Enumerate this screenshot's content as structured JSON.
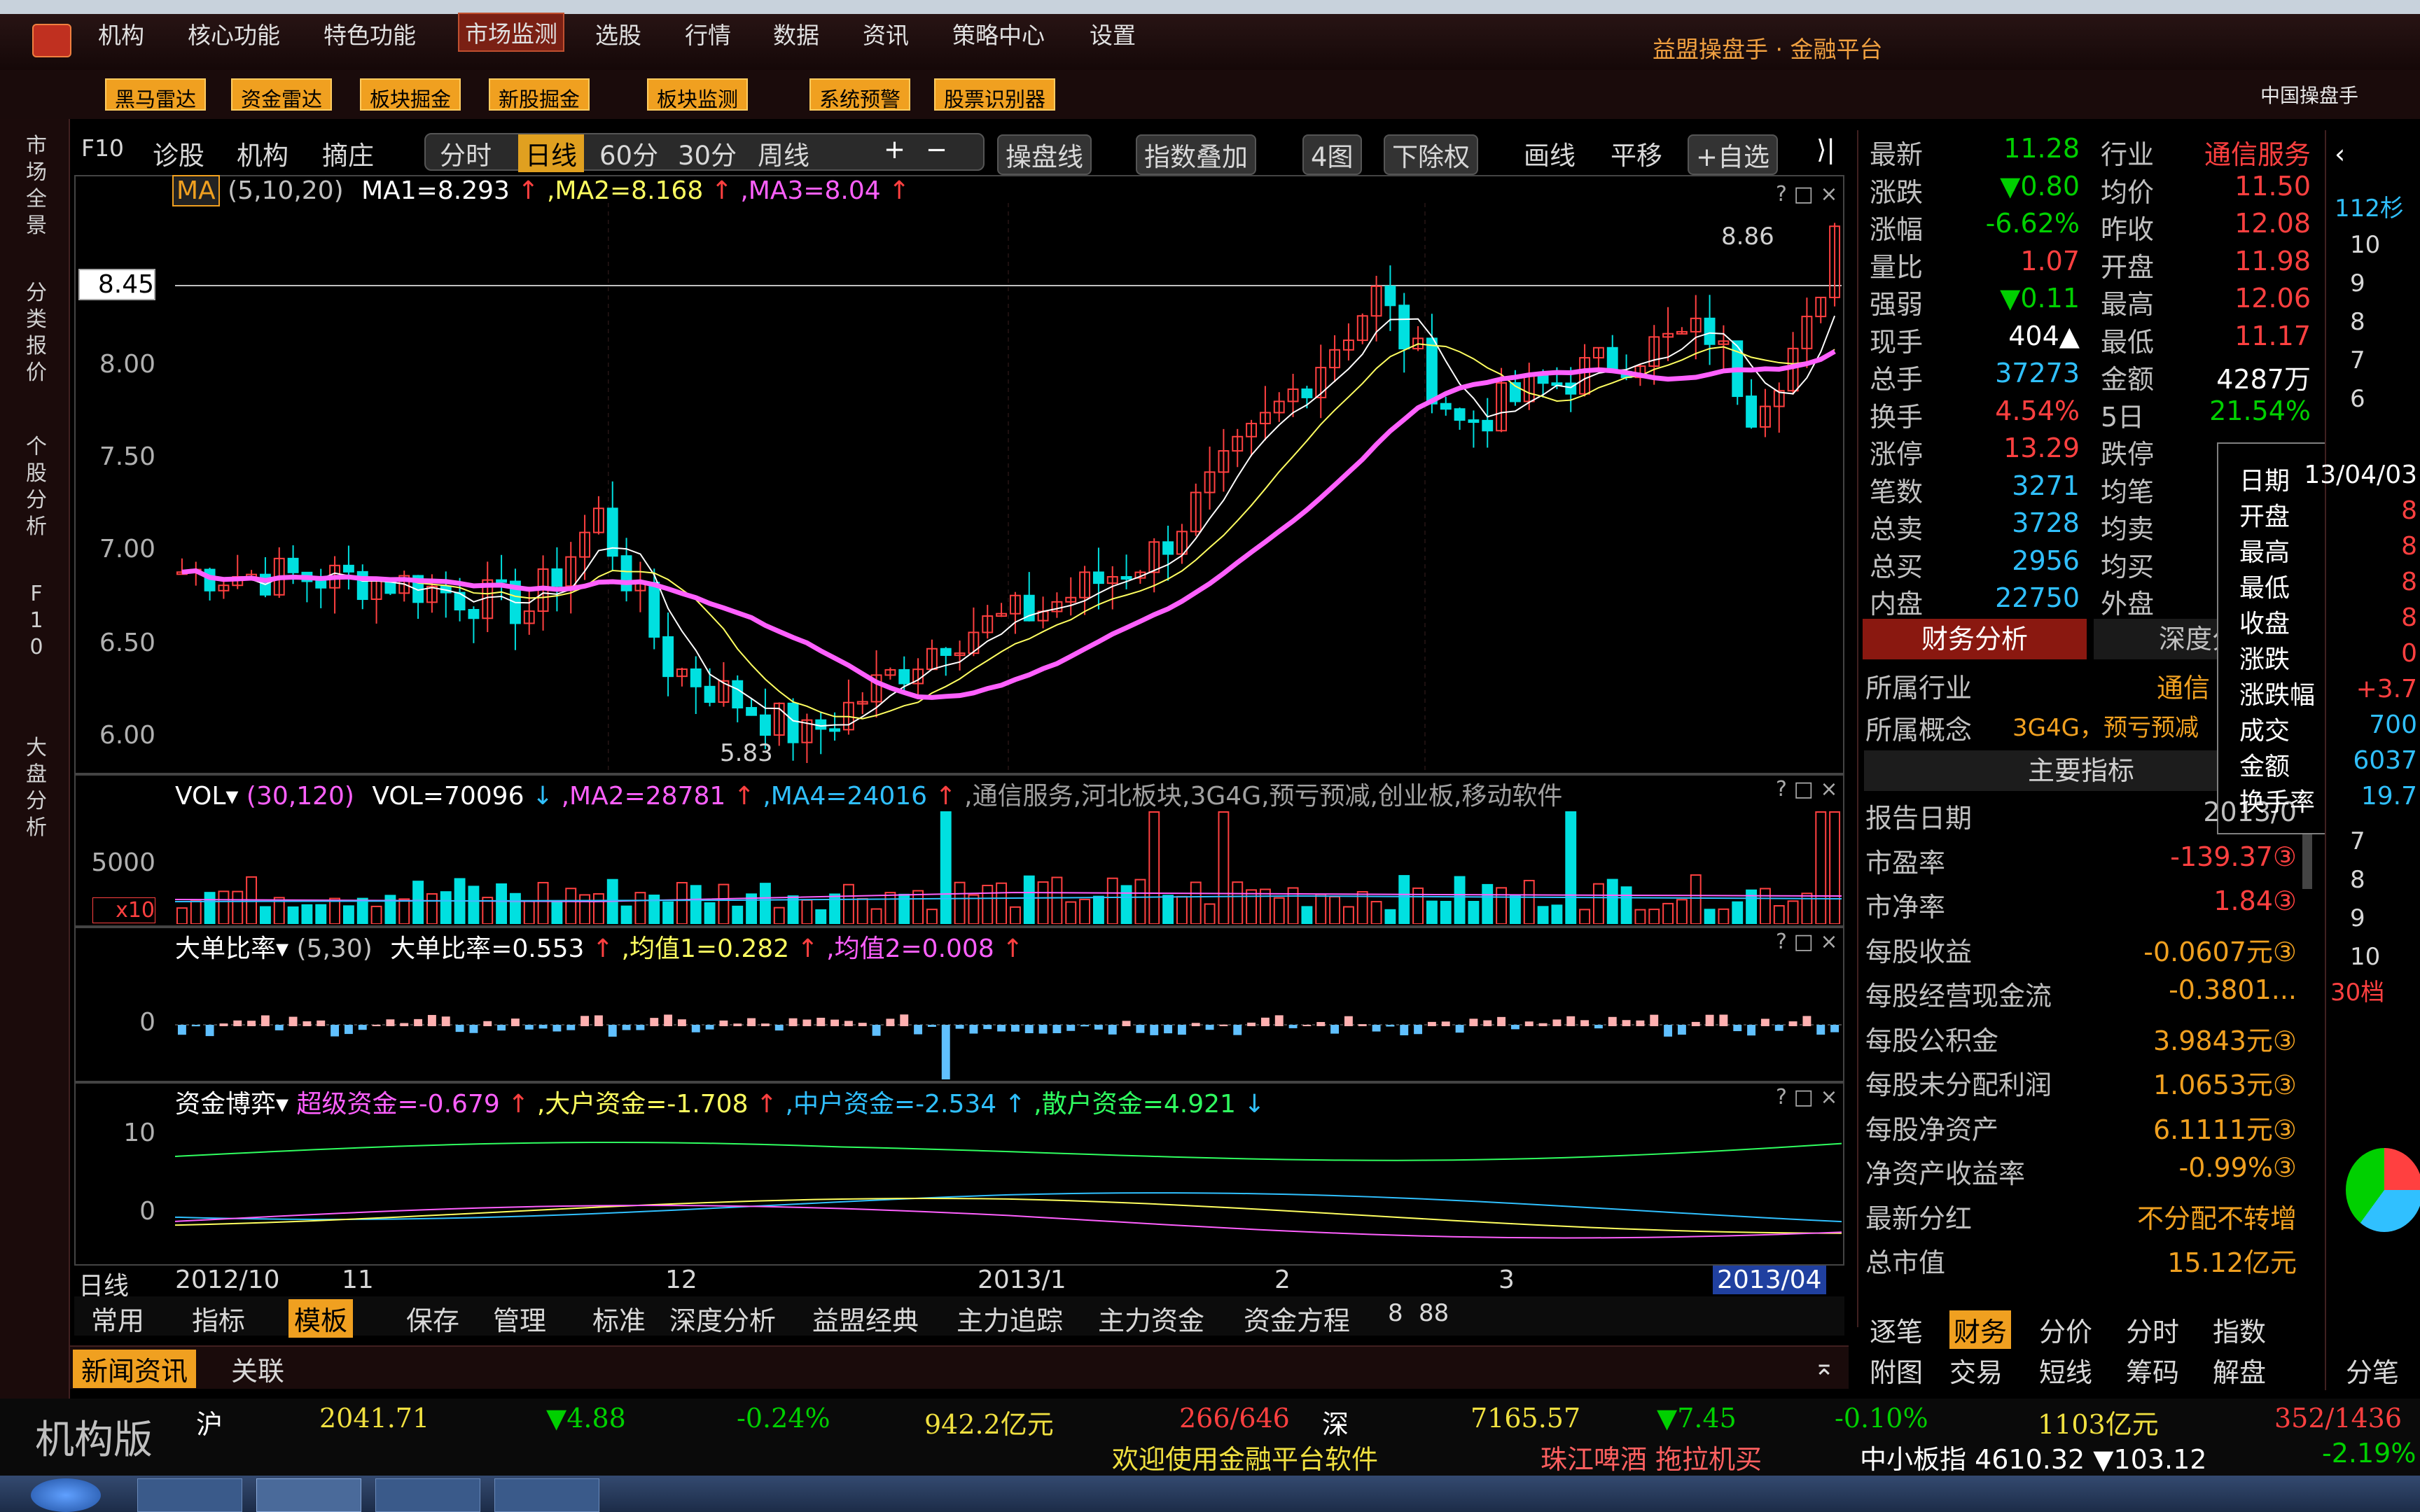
{
  "menu": [
    "机构",
    "核心功能",
    "特色功能",
    "市场监测",
    "选股",
    "行情",
    "数据",
    "资讯",
    "策略中心",
    "设置"
  ],
  "menu_active": 3,
  "brand": "益盟操盘手 · 金融平台",
  "toolbar2": [
    "黑马雷达",
    "资金雷达",
    "板块掘金",
    "新股掘金",
    "板块监测",
    "系统预警",
    "股票识别器"
  ],
  "toolbar2_right": "中国操盘手",
  "left_tabs": [
    "市场全景",
    "分类报价",
    "个股分析",
    "F10",
    "大盘分析"
  ],
  "chart_toolbar": {
    "f10": "F10",
    "items": [
      "诊股",
      "机构",
      "摘庄"
    ],
    "periods": [
      "分时",
      "日线",
      "60分",
      "30分",
      "周线"
    ],
    "period_active": 1,
    "plus": "+",
    "minus": "−",
    "right": [
      "操盘线",
      "指数叠加",
      "4图",
      "下除权",
      "画线",
      "平移",
      "+自选"
    ]
  },
  "ma_legend": {
    "name": "MA",
    "params": "(5,10,20)",
    "ma1": "MA1=8.293",
    "ma2": ",MA2=8.168",
    "ma3": ",MA3=8.04"
  },
  "price_axis": [
    "8.45",
    "8.00",
    "7.50",
    "7.00",
    "6.50",
    "6.00"
  ],
  "price_labels": {
    "high": "8.86",
    "low": "5.83",
    "hline": "8.45"
  },
  "vol_legend": {
    "name": "VOL",
    "params": "(30,120)",
    "vol": "VOL=70096",
    "ma2": ",MA2=28781",
    "ma4": ",MA4=24016",
    "tags": ",通信服务,河北板块,3G4G,预亏预减,创业板,移动软件"
  },
  "vol_axis": [
    "5000",
    "x10"
  ],
  "ddr_legend": {
    "name": "大单比率",
    "params": "(5,30)",
    "val": "大单比率=0.553",
    "avg1": ",均值1=0.282",
    "avg2": ",均值2=0.008"
  },
  "ddr_axis": [
    "0"
  ],
  "fund_legend": {
    "name": "资金博弈",
    "super": "超级资金=-0.679",
    "big": ",大户资金=-1.708",
    "mid": ",中户资金=-2.534",
    "small": ",散户资金=4.921"
  },
  "fund_axis": [
    "10",
    "0"
  ],
  "date_axis": {
    "period": "日线",
    "ticks": [
      "2012/10",
      "11",
      "12",
      "2013/1",
      "2",
      "3"
    ],
    "current": "2013/04"
  },
  "bottom_tool": {
    "tabs": [
      "常用",
      "指标",
      "模板"
    ],
    "active": 2,
    "items": [
      "保存",
      "管理",
      "标准",
      "深度分析",
      "益盟经典",
      "主力追踪",
      "主力资金",
      "资金方程",
      "8",
      "88"
    ]
  },
  "news_tabs": [
    "新闻资讯",
    "关联"
  ],
  "quote": [
    [
      "最新",
      "11.28",
      "行业",
      "通信服务"
    ],
    [
      "涨跌",
      "▼0.80",
      "均价",
      "11.50"
    ],
    [
      "涨幅",
      "-6.62%",
      "昨收",
      "12.08"
    ],
    [
      "量比",
      "1.07",
      "开盘",
      "11.98"
    ],
    [
      "强弱",
      "▼0.11",
      "最高",
      "12.06"
    ],
    [
      "现手",
      "404▲",
      "最低",
      "11.17"
    ],
    [
      "总手",
      "37273",
      "金额",
      "4287万"
    ],
    [
      "换手",
      "4.54%",
      "5日",
      "21.54%"
    ],
    [
      "涨停",
      "13.29",
      "跌停",
      ""
    ],
    [
      "笔数",
      "3271",
      "均笔",
      ""
    ],
    [
      "总卖",
      "3728",
      "均卖",
      ""
    ],
    [
      "总买",
      "2956",
      "均买",
      ""
    ],
    [
      "内盘",
      "22750",
      "外盘",
      ""
    ]
  ],
  "fin_tabs": [
    "财务分析",
    "深度分"
  ],
  "industry": {
    "label": "所属行业",
    "value": "通信"
  },
  "concept": {
    "label": "所属概念",
    "value": "3G4G，预亏预减"
  },
  "main_index_title": "主要指标",
  "fin_rows": [
    [
      "报告日期",
      "2013/0"
    ],
    [
      "市盈率",
      "-139.37③"
    ],
    [
      "市净率",
      "1.84③"
    ],
    [
      "每股收益",
      "-0.0607元③"
    ],
    [
      "每股经营现金流",
      "-0.3801..."
    ],
    [
      "每股公积金",
      "3.9843元③"
    ],
    [
      "每股未分配利润",
      "1.0653元③"
    ],
    [
      "每股净资产",
      "6.1111元③"
    ],
    [
      "净资产收益率",
      "-0.99%③"
    ],
    [
      "最新分红",
      "不分配不转增"
    ],
    [
      "总市值",
      "15.12亿元"
    ]
  ],
  "right_tabs_row1": [
    "逐笔",
    "财务",
    "分价",
    "分时",
    "指数"
  ],
  "right_tabs_active": 1,
  "right_tabs_row2": [
    "附图",
    "交易",
    "短线",
    "筹码",
    "解盘"
  ],
  "tooltip": [
    [
      "日期",
      "13/04/03"
    ],
    [
      "开盘",
      "8"
    ],
    [
      "最高",
      "8"
    ],
    [
      "最低",
      "8"
    ],
    [
      "收盘",
      "8"
    ],
    [
      "涨跌",
      "0"
    ],
    [
      "涨跌幅",
      "+3.7"
    ],
    [
      "成交",
      "700"
    ],
    [
      "金额",
      "6037"
    ],
    [
      "换手率",
      "19.7"
    ]
  ],
  "far_right": {
    "tab": "112杉",
    "nums": [
      "10",
      "9",
      "8",
      "7",
      "6",
      "7",
      "8",
      "9",
      "10"
    ],
    "level": "30档",
    "bottom": "分笔"
  },
  "status": {
    "edition": "机构版",
    "sh": "沪",
    "sh_idx": "2041.71",
    "sh_chg": "▼4.88",
    "sh_pct": "-0.24%",
    "sh_amt": "942.2亿元",
    "sh_cnt": "266/646",
    "sz": "深",
    "sz_idx": "7165.57",
    "sz_chg": "▼7.45",
    "sz_pct": "-0.10%",
    "sz_amt": "1103亿元",
    "sz_cnt": "352/1436",
    "welcome": "欢迎使用金融平台软件",
    "ticker": "珠江啤酒 拖拉机买",
    "sme": "中小板指 4610.32 ▼103.12",
    "sme_pct": "-2.19%"
  },
  "colors": {
    "up": "#ff4040",
    "down": "#00e0e0",
    "ma1": "#ffffff",
    "ma2": "#ffff60",
    "ma3": "#ff60ff",
    "active": "#f0a020"
  }
}
